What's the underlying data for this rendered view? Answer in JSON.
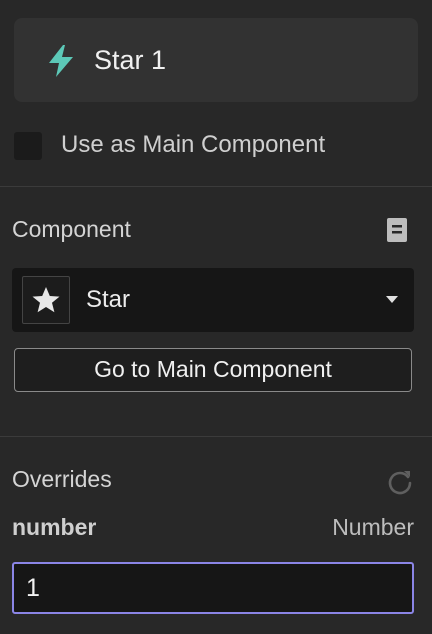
{
  "layer": {
    "name": "Star 1",
    "icon": "bolt-icon",
    "icon_color": "#5cc8b7"
  },
  "main_component_toggle": {
    "label": "Use as Main Component",
    "checked": false
  },
  "component_section": {
    "title": "Component",
    "docs_icon": "document-icon",
    "selected": {
      "value": "Star",
      "thumbnail_icon": "star-icon"
    },
    "goto_label": "Go to Main Component"
  },
  "overrides_section": {
    "title": "Overrides",
    "reset_icon": "refresh-icon",
    "property": {
      "name": "number",
      "type": "Number",
      "value": "1"
    }
  },
  "colors": {
    "background": "#282828",
    "focus_border": "#8b85e6"
  }
}
